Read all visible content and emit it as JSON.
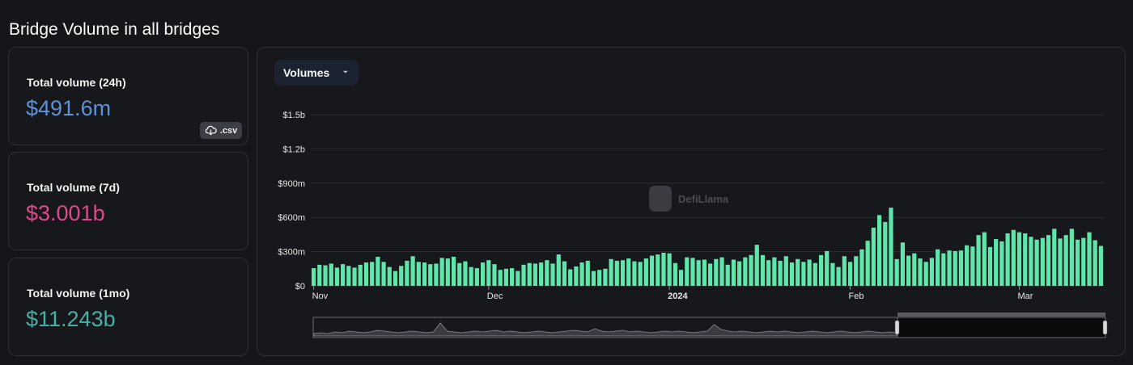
{
  "title": "Bridge Volume in all bridges",
  "cards": [
    {
      "label": "Total volume (24h)",
      "value": "$491.6m",
      "color": "#5b92d9"
    },
    {
      "label": "Total volume (7d)",
      "value": "$3.001b",
      "color": "#dd4a8c"
    },
    {
      "label": "Total volume (1mo)",
      "value": "$11.243b",
      "color": "#44b0a8"
    }
  ],
  "csv_label": ".csv",
  "dropdown_label": "Volumes",
  "watermark": "DefiLlama",
  "colors": {
    "bar": "#5ee6ab",
    "grid": "#2a2c31",
    "axis_text": "#e6e6e6"
  },
  "chart_data": {
    "type": "bar",
    "title": "",
    "xlabel": "",
    "ylabel": "",
    "ylim": [
      0,
      1500
    ],
    "y_unit": "USD millions",
    "y_ticks": [
      0,
      300,
      600,
      900,
      1200,
      1500
    ],
    "y_tick_labels": [
      "$0",
      "$300m",
      "$600m",
      "$900m",
      "$1.2b",
      "$1.5b"
    ],
    "x_tick_labels": [
      {
        "label": "Nov",
        "index": 0
      },
      {
        "label": "Dec",
        "index": 30
      },
      {
        "label": "2024",
        "index": 61
      },
      {
        "label": "Feb",
        "index": 92
      },
      {
        "label": "Mar",
        "index": 121
      }
    ],
    "x_range": {
      "start": "2023-11-01",
      "end": "2024-03-10"
    },
    "grid": true,
    "legend": "none",
    "series": [
      {
        "values": [
          155,
          185,
          180,
          195,
          160,
          190,
          175,
          160,
          185,
          205,
          210,
          255,
          210,
          165,
          130,
          175,
          220,
          260,
          210,
          205,
          190,
          195,
          245,
          240,
          255,
          200,
          215,
          165,
          155,
          205,
          225,
          190,
          140,
          150,
          155,
          130,
          185,
          200,
          195,
          205,
          225,
          195,
          275,
          215,
          145,
          170,
          205,
          220,
          130,
          140,
          150,
          235,
          220,
          225,
          240,
          215,
          210,
          240,
          265,
          275,
          290,
          285,
          200,
          140,
          250,
          245,
          225,
          230,
          195,
          235,
          250,
          185,
          230,
          215,
          250,
          270,
          360,
          270,
          225,
          250,
          220,
          260,
          205,
          235,
          210,
          230,
          200,
          270,
          305,
          200,
          165,
          260,
          210,
          260,
          320,
          395,
          510,
          620,
          560,
          685,
          235,
          380,
          265,
          285,
          240,
          210,
          245,
          320,
          285,
          310,
          305,
          310,
          355,
          345,
          445,
          470,
          340,
          410,
          390,
          460,
          490,
          470,
          460,
          430,
          405,
          420,
          445,
          500,
          415,
          445,
          500,
          405,
          420,
          470,
          400,
          350
        ]
      }
    ]
  }
}
